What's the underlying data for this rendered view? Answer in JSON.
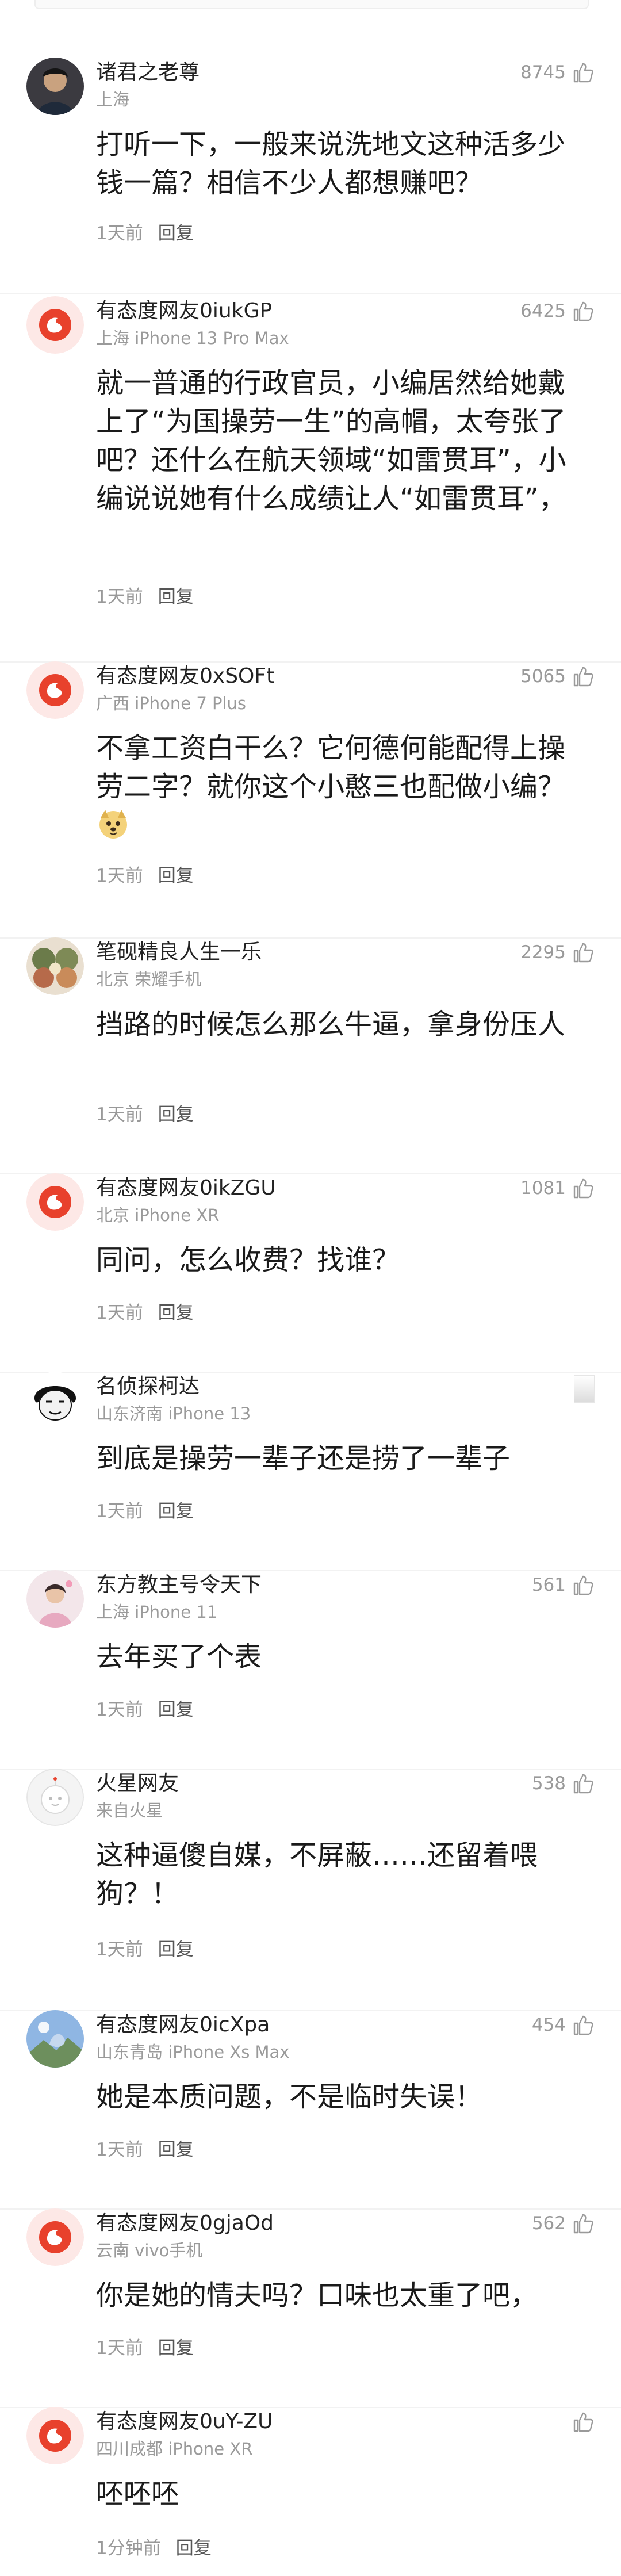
{
  "reply_label": "回复",
  "comments": [
    {
      "user": "诸君之老尊",
      "info": "上海",
      "likes": "8745",
      "text": "打听一下，一般来说洗地文这种活多少钱一篇？相信不少人都想赚吧？",
      "time": "1天前"
    },
    {
      "user": "有态度网友0iukGP",
      "info": "上海 iPhone 13 Pro Max",
      "likes": "6425",
      "text": "就一普通的行政官员，小编居然给她戴上了“为国操劳一生”的高帽，太夸张了吧？还什么在航天领域“如雷贯耳”，小编说说她有什么成绩让人“如雷贯耳”，她那句“外交豁免…",
      "time": "1天前"
    },
    {
      "user": "有态度网友0xSOFt",
      "info": "广西 iPhone 7 Plus",
      "likes": "5065",
      "text": "不拿工资白干么？它何德何能配得上操劳二字？就你这个小憨三也配做小编？",
      "time": "1天前"
    },
    {
      "user": "笔砚精良人生一乐",
      "info": "北京 荣耀手机",
      "likes": "2295",
      "text": "挡路的时候怎么那么牛逼，拿身份压人",
      "time": "1天前"
    },
    {
      "user": "有态度网友0ikZGU",
      "info": "北京 iPhone XR",
      "likes": "1081",
      "text": "同问，怎么收费？找谁？",
      "time": "1天前"
    },
    {
      "user": "名侦探柯达",
      "info": "山东济南 iPhone 13",
      "likes": "",
      "text": "到底是操劳一辈子还是捞了一辈子",
      "time": "1天前"
    },
    {
      "user": "东方教主号令天下",
      "info": "上海 iPhone 11",
      "likes": "561",
      "text": "去年买了个表",
      "time": "1天前"
    },
    {
      "user": "火星网友",
      "info": "来自火星",
      "likes": "538",
      "text": "这种逼傻自媒，不屏蔽……还留着喂狗？！",
      "time": "1天前"
    },
    {
      "user": "有态度网友0icXpa",
      "info": "山东青岛 iPhone Xs Max",
      "likes": "454",
      "text": "她是本质问题，不是临时失误！",
      "time": "1天前"
    },
    {
      "user": "有态度网友0gjaOd",
      "info": "云南 vivo手机",
      "likes": "562",
      "text": "你是她的情夫吗？口味也太重了吧，",
      "time": "1天前"
    },
    {
      "user": "有态度网友0uY-ZU",
      "info": "四川成都 iPhone XR",
      "likes": "",
      "text": "呸呸呸",
      "time": "1分钟前"
    }
  ]
}
